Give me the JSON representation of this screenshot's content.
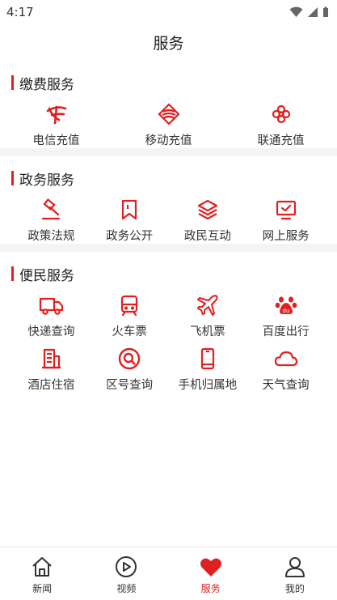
{
  "status_bar": {
    "time": "4:17"
  },
  "header": {
    "title": "服务"
  },
  "sections": [
    {
      "title": "缴费服务",
      "items": [
        {
          "label": "电信充值",
          "icon": "china-telecom-icon"
        },
        {
          "label": "移动充值",
          "icon": "china-mobile-icon"
        },
        {
          "label": "联通充值",
          "icon": "china-unicom-icon"
        }
      ]
    },
    {
      "title": "政务服务",
      "items": [
        {
          "label": "政策法规",
          "icon": "gavel-icon"
        },
        {
          "label": "政务公开",
          "icon": "bookmark-icon"
        },
        {
          "label": "政民互动",
          "icon": "layers-icon"
        },
        {
          "label": "网上服务",
          "icon": "monitor-check-icon"
        }
      ]
    },
    {
      "title": "便民服务",
      "items": [
        {
          "label": "快递查询",
          "icon": "truck-icon"
        },
        {
          "label": "火车票",
          "icon": "train-icon"
        },
        {
          "label": "飞机票",
          "icon": "airplane-icon"
        },
        {
          "label": "百度出行",
          "icon": "baidu-paw-icon"
        },
        {
          "label": "酒店住宿",
          "icon": "building-icon"
        },
        {
          "label": "区号查询",
          "icon": "search-circle-icon"
        },
        {
          "label": "手机归属地",
          "icon": "phone-icon"
        },
        {
          "label": "天气查询",
          "icon": "cloud-icon"
        }
      ]
    }
  ],
  "tabbar": {
    "tabs": [
      {
        "label": "新闻",
        "icon": "home-icon",
        "active": false
      },
      {
        "label": "视频",
        "icon": "play-circle-icon",
        "active": false
      },
      {
        "label": "服务",
        "icon": "heart-icon",
        "active": true
      },
      {
        "label": "我的",
        "icon": "user-icon",
        "active": false
      }
    ]
  },
  "colors": {
    "accent": "#e02020",
    "divider": "#f4f4f4",
    "text": "#333333"
  }
}
